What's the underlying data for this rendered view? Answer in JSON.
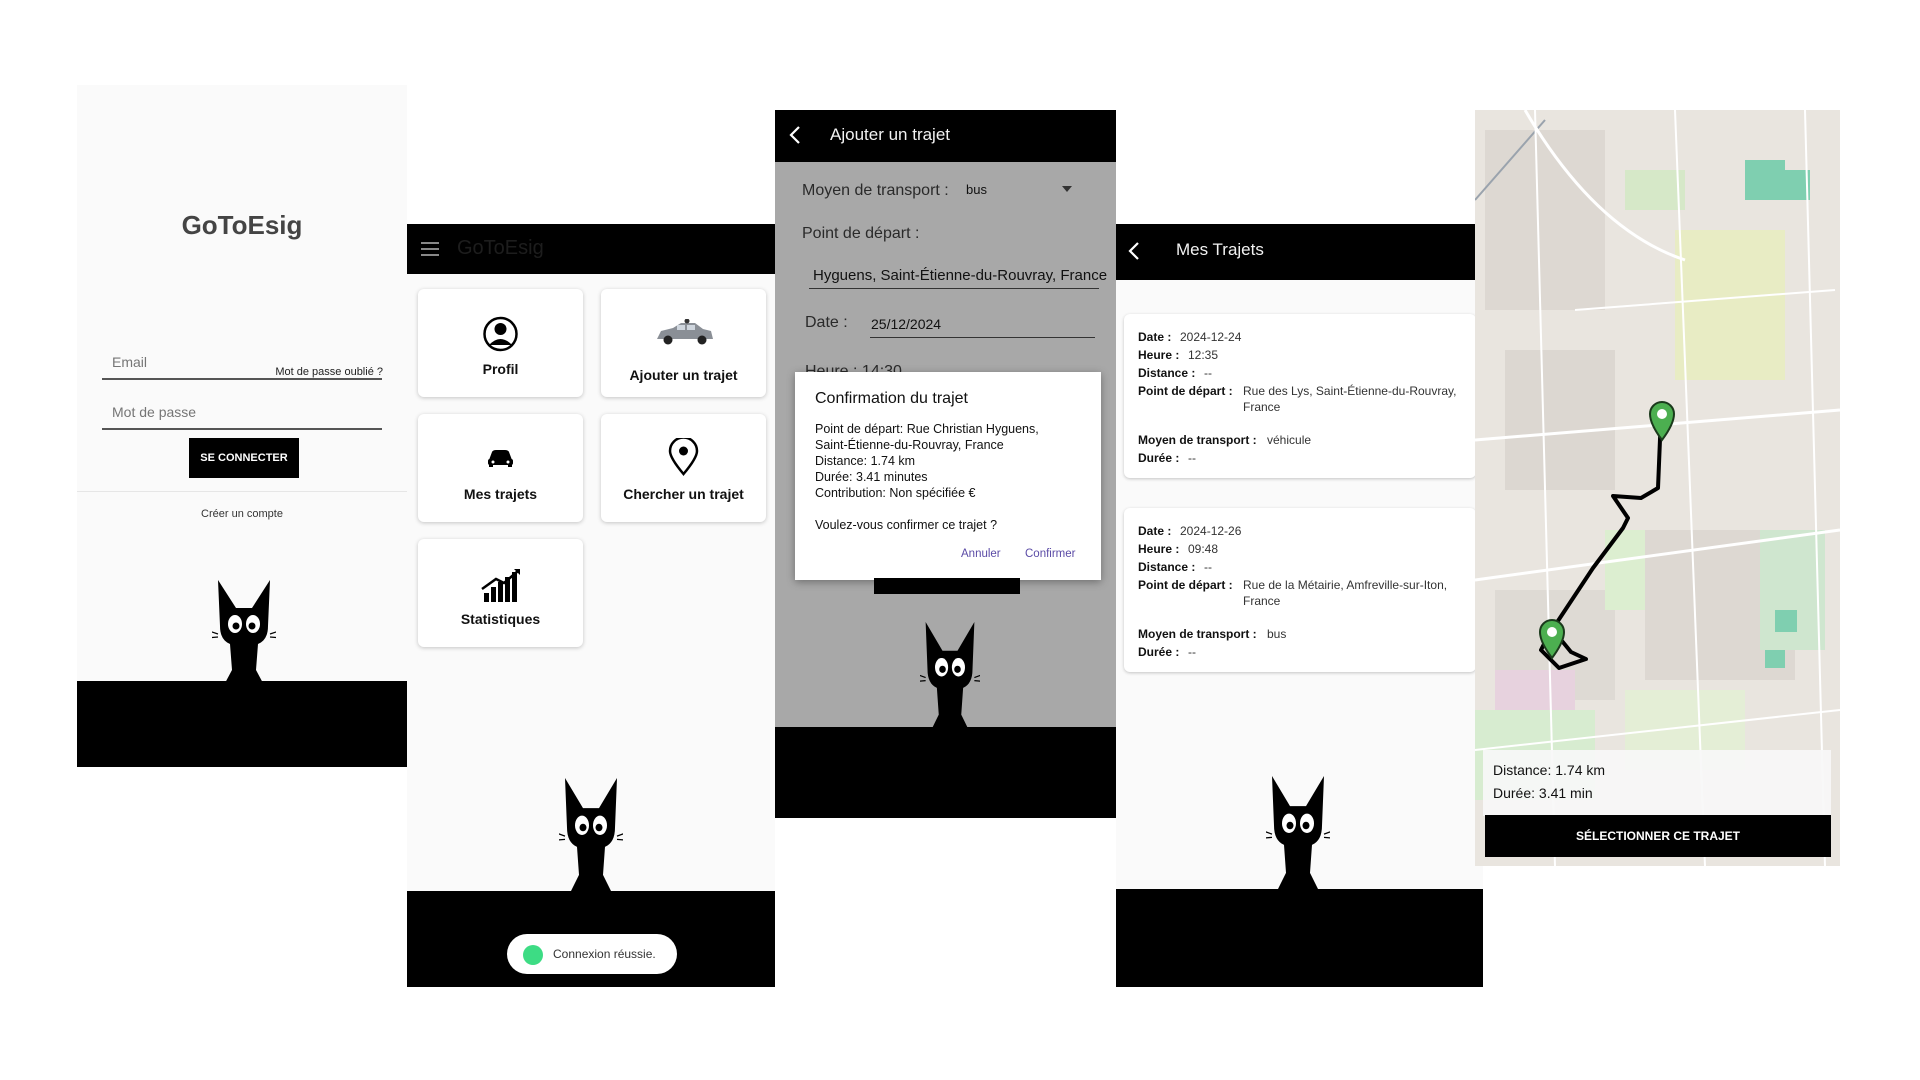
{
  "login": {
    "title": "GoToEsig",
    "email_placeholder": "Email",
    "password_placeholder": "Mot de passe",
    "forgot_password": "Mot de passe oublié ?",
    "login_button": "SE CONNECTER",
    "create_account": "Créer un compte"
  },
  "home": {
    "app_title": "GoToEsig",
    "tiles": [
      {
        "label": "Profil",
        "icon": "profile-icon"
      },
      {
        "label": "Ajouter un trajet",
        "icon": "car-icon"
      },
      {
        "label": "Mes trajets",
        "icon": "car-front-icon"
      },
      {
        "label": "Chercher un trajet",
        "icon": "location-pin-icon"
      },
      {
        "label": "Statistiques",
        "icon": "stats-icon"
      }
    ],
    "toast": "Connexion réussie."
  },
  "add_trip": {
    "title": "Ajouter un trajet",
    "transport_label": "Moyen de transport :",
    "transport_value": "bus",
    "departure_label": "Point de départ :",
    "departure_value": "Hyguens, Saint-Étienne-du-Rouvray, France",
    "date_label": "Date :",
    "date_value": "25/12/2024",
    "hour_partial": "Heure : 14:30",
    "dialog": {
      "title": "Confirmation du trajet",
      "lines": [
        "Point de départ: Rue Christian Hyguens,",
        "Saint-Étienne-du-Rouvray, France",
        "Distance: 1.74 km",
        "Durée: 3.41 minutes",
        "Contribution: Non spécifiée €"
      ],
      "question": "Voulez-vous confirmer ce trajet ?",
      "cancel": "Annuler",
      "confirm": "Confirmer"
    }
  },
  "my_trips": {
    "title": "Mes Trajets",
    "labels": {
      "date": "Date :",
      "hour": "Heure :",
      "distance": "Distance :",
      "departure": "Point de départ :",
      "transport": "Moyen de transport :",
      "duration": "Durée :"
    },
    "trips": [
      {
        "date": "2024-12-24",
        "hour": "12:35",
        "distance": "--",
        "departure_line1": "Rue des Lys, Saint-Étienne-du-Rouvray,",
        "departure_line2": "France",
        "transport": "véhicule",
        "duration": "--"
      },
      {
        "date": "2024-12-26",
        "hour": "09:48",
        "distance": "--",
        "departure_line1": "Rue de la Métairie, Amfreville-sur-Iton,",
        "departure_line2": "France",
        "transport": "bus",
        "duration": "--"
      }
    ]
  },
  "map": {
    "distance": "Distance: 1.74 km",
    "duration": "Durée: 3.41 min",
    "select_button": "SÉLECTIONNER CE TRAJET"
  },
  "colors": {
    "accent_purple": "#5b4ba6",
    "toast_green": "#3ddc84",
    "pin_green": "#4caf50",
    "black": "#000000"
  }
}
